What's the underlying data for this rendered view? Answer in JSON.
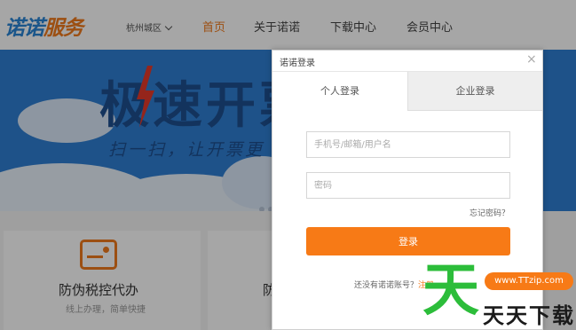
{
  "header": {
    "logo_part1": "诺诺",
    "logo_part2": "服务",
    "region": "杭州城区",
    "nav": [
      "首页",
      "关于诺诺",
      "下载中心",
      "会员中心"
    ]
  },
  "banner": {
    "title": "极速开票",
    "subtitle": "扫一扫，让开票更"
  },
  "cards": [
    {
      "title": "防伪税控代办",
      "desc": "线上办理，简单快捷"
    },
    {
      "title": "防"
    }
  ],
  "login": {
    "title": "诺诺登录",
    "close": "×",
    "tabs": [
      "个人登录",
      "企业登录"
    ],
    "phone_placeholder": "手机号/邮箱/用户名",
    "password_placeholder": "密码",
    "forgot": "忘记密码？",
    "submit": "登录",
    "register_prompt": "还没有诺诺账号？",
    "register_link": "注册"
  },
  "watermark": {
    "char": "天",
    "badge": "www.TTzip.com",
    "text": "天天下载"
  },
  "colors": {
    "brand_blue": "#2a84d4",
    "accent_orange": "#f07a1c",
    "banner_blue": "#2f7fd3",
    "watermark_green": "#2cbd3a"
  }
}
